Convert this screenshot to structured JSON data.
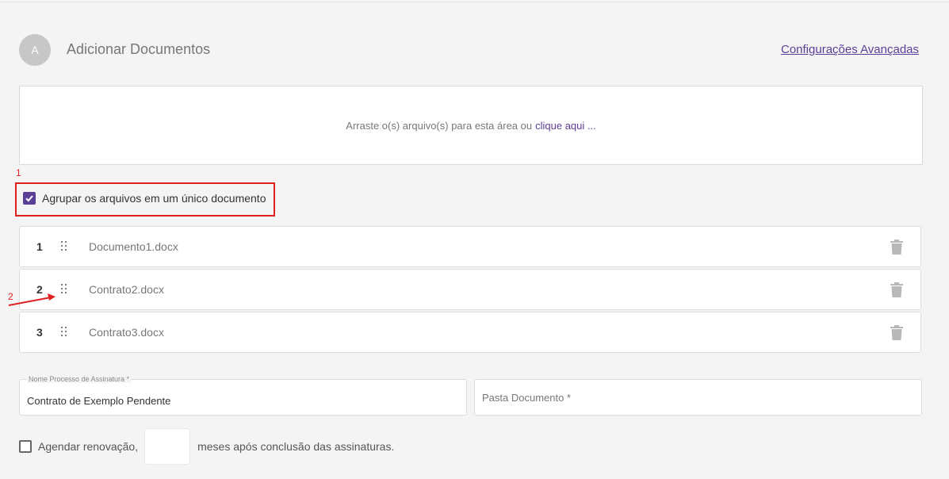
{
  "header": {
    "avatar_letter": "A",
    "title": "Adicionar Documentos",
    "advanced_link": "Configurações Avançadas"
  },
  "dropzone": {
    "text": "Arraste o(s) arquivo(s) para esta área ou",
    "link": "clique aqui ..."
  },
  "annotations": {
    "one": "1",
    "two": "2"
  },
  "group_files": {
    "label": "Agrupar os arquivos em um único documento",
    "checked": true
  },
  "files": [
    {
      "num": "1",
      "name": "Documento1.docx"
    },
    {
      "num": "2",
      "name": "Contrato2.docx"
    },
    {
      "num": "3",
      "name": "Contrato3.docx"
    }
  ],
  "fields": {
    "process_name": {
      "label": "Nome Processo de Assinatura *",
      "value": "Contrato de Exemplo Pendente"
    },
    "folder": {
      "placeholder": "Pasta Documento *"
    }
  },
  "renewal": {
    "label": "Agendar renovação,",
    "suffix": "meses após conclusão das assinaturas.",
    "checked": false
  },
  "colors": {
    "accent": "#5b3e96",
    "annotation": "#e02020"
  }
}
